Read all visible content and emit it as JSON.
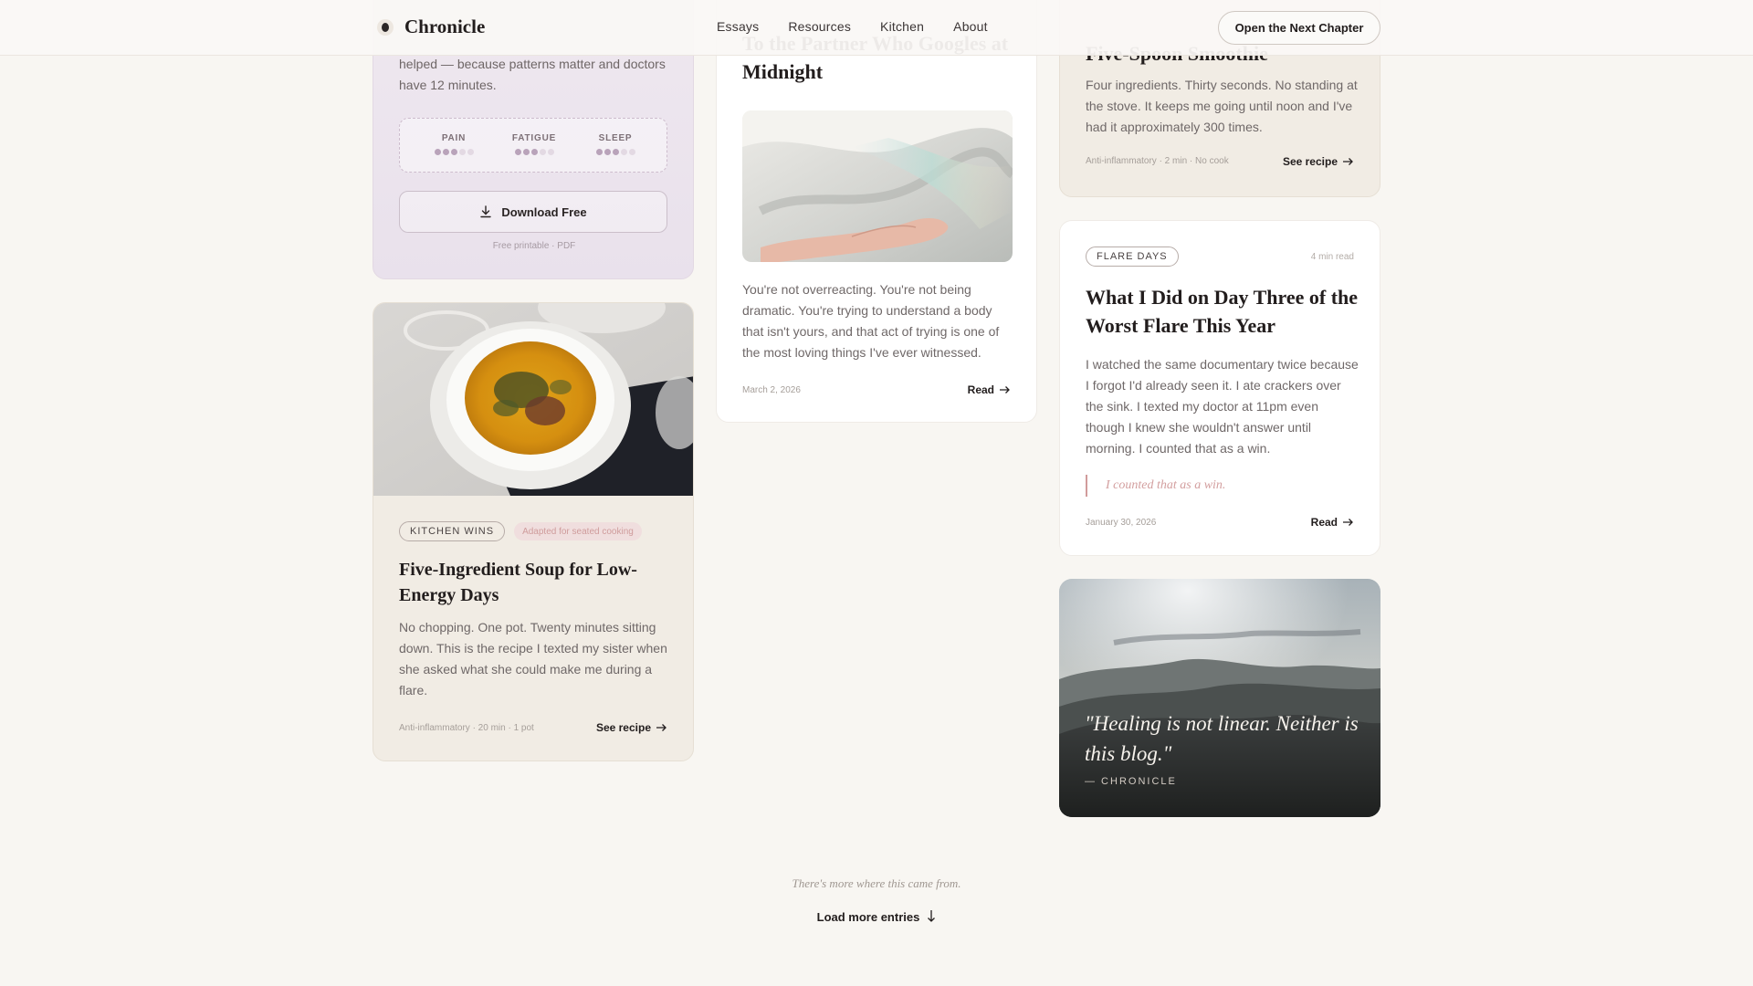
{
  "header": {
    "brand": "Chronicle",
    "nav": [
      "Essays",
      "Resources",
      "Kitchen",
      "About"
    ],
    "cta": "Open the Next Chapter"
  },
  "tracker_card": {
    "description": "helped — because patterns matter and doctors have 12 minutes.",
    "metrics": [
      {
        "label": "PAIN",
        "level": 3,
        "max": 5
      },
      {
        "label": "FATIGUE",
        "level": 3,
        "max": 5
      },
      {
        "label": "SLEEP",
        "level": 3,
        "max": 5
      }
    ],
    "button": "Download Free",
    "note": "Free printable · PDF"
  },
  "soup_card": {
    "tag": "KITCHEN WINS",
    "badge": "Adapted for seated cooking",
    "title": "Five-Ingredient Soup for Low-Energy Days",
    "excerpt": "No chopping. One pot. Twenty minutes sitting down. This is the recipe I texted my sister when she asked what she could make me during a flare.",
    "meta": "Anti-inflammatory · 20 min · 1 pot",
    "link": "See recipe"
  },
  "letter_card": {
    "title": "To the Partner Who Googles at Midnight",
    "excerpt": "You're not overreacting. You're not being dramatic. You're trying to understand a body that isn't yours, and that act of trying is one of the most loving things I've ever witnessed.",
    "date": "March 2, 2026",
    "link": "Read"
  },
  "recipe_card": {
    "title": "Five-Spoon Smoothie",
    "excerpt": "Four ingredients. Thirty seconds. No standing at the stove. It keeps me going until noon and I've had it approximately 300 times.",
    "meta": "Anti-inflammatory · 2 min · No cook",
    "link": "See recipe"
  },
  "flare_card": {
    "tag": "FLARE DAYS",
    "read_time": "4 min read",
    "title": "What I Did on Day Three of the Worst Flare This Year",
    "excerpt": "I watched the same documentary twice because I forgot I'd already seen it. I ate crackers over the sink. I texted my doctor at 11pm even though I knew she wouldn't answer until morning. I counted that as a win.",
    "pullquote": "I counted that as a win.",
    "date": "January 30, 2026",
    "link": "Read"
  },
  "quote_card": {
    "quote": "\"Healing is not linear. Neither is this blog.\"",
    "attribution": "— CHRONICLE"
  },
  "footer": {
    "more_text": "There's more where this came from.",
    "load_more": "Load more entries"
  },
  "colors": {
    "background": "#f8f6f2",
    "accent_rose": "#d19b9b",
    "tracker_lavender": "#ebe3ec",
    "kitchen_cream": "#f1ece4"
  }
}
